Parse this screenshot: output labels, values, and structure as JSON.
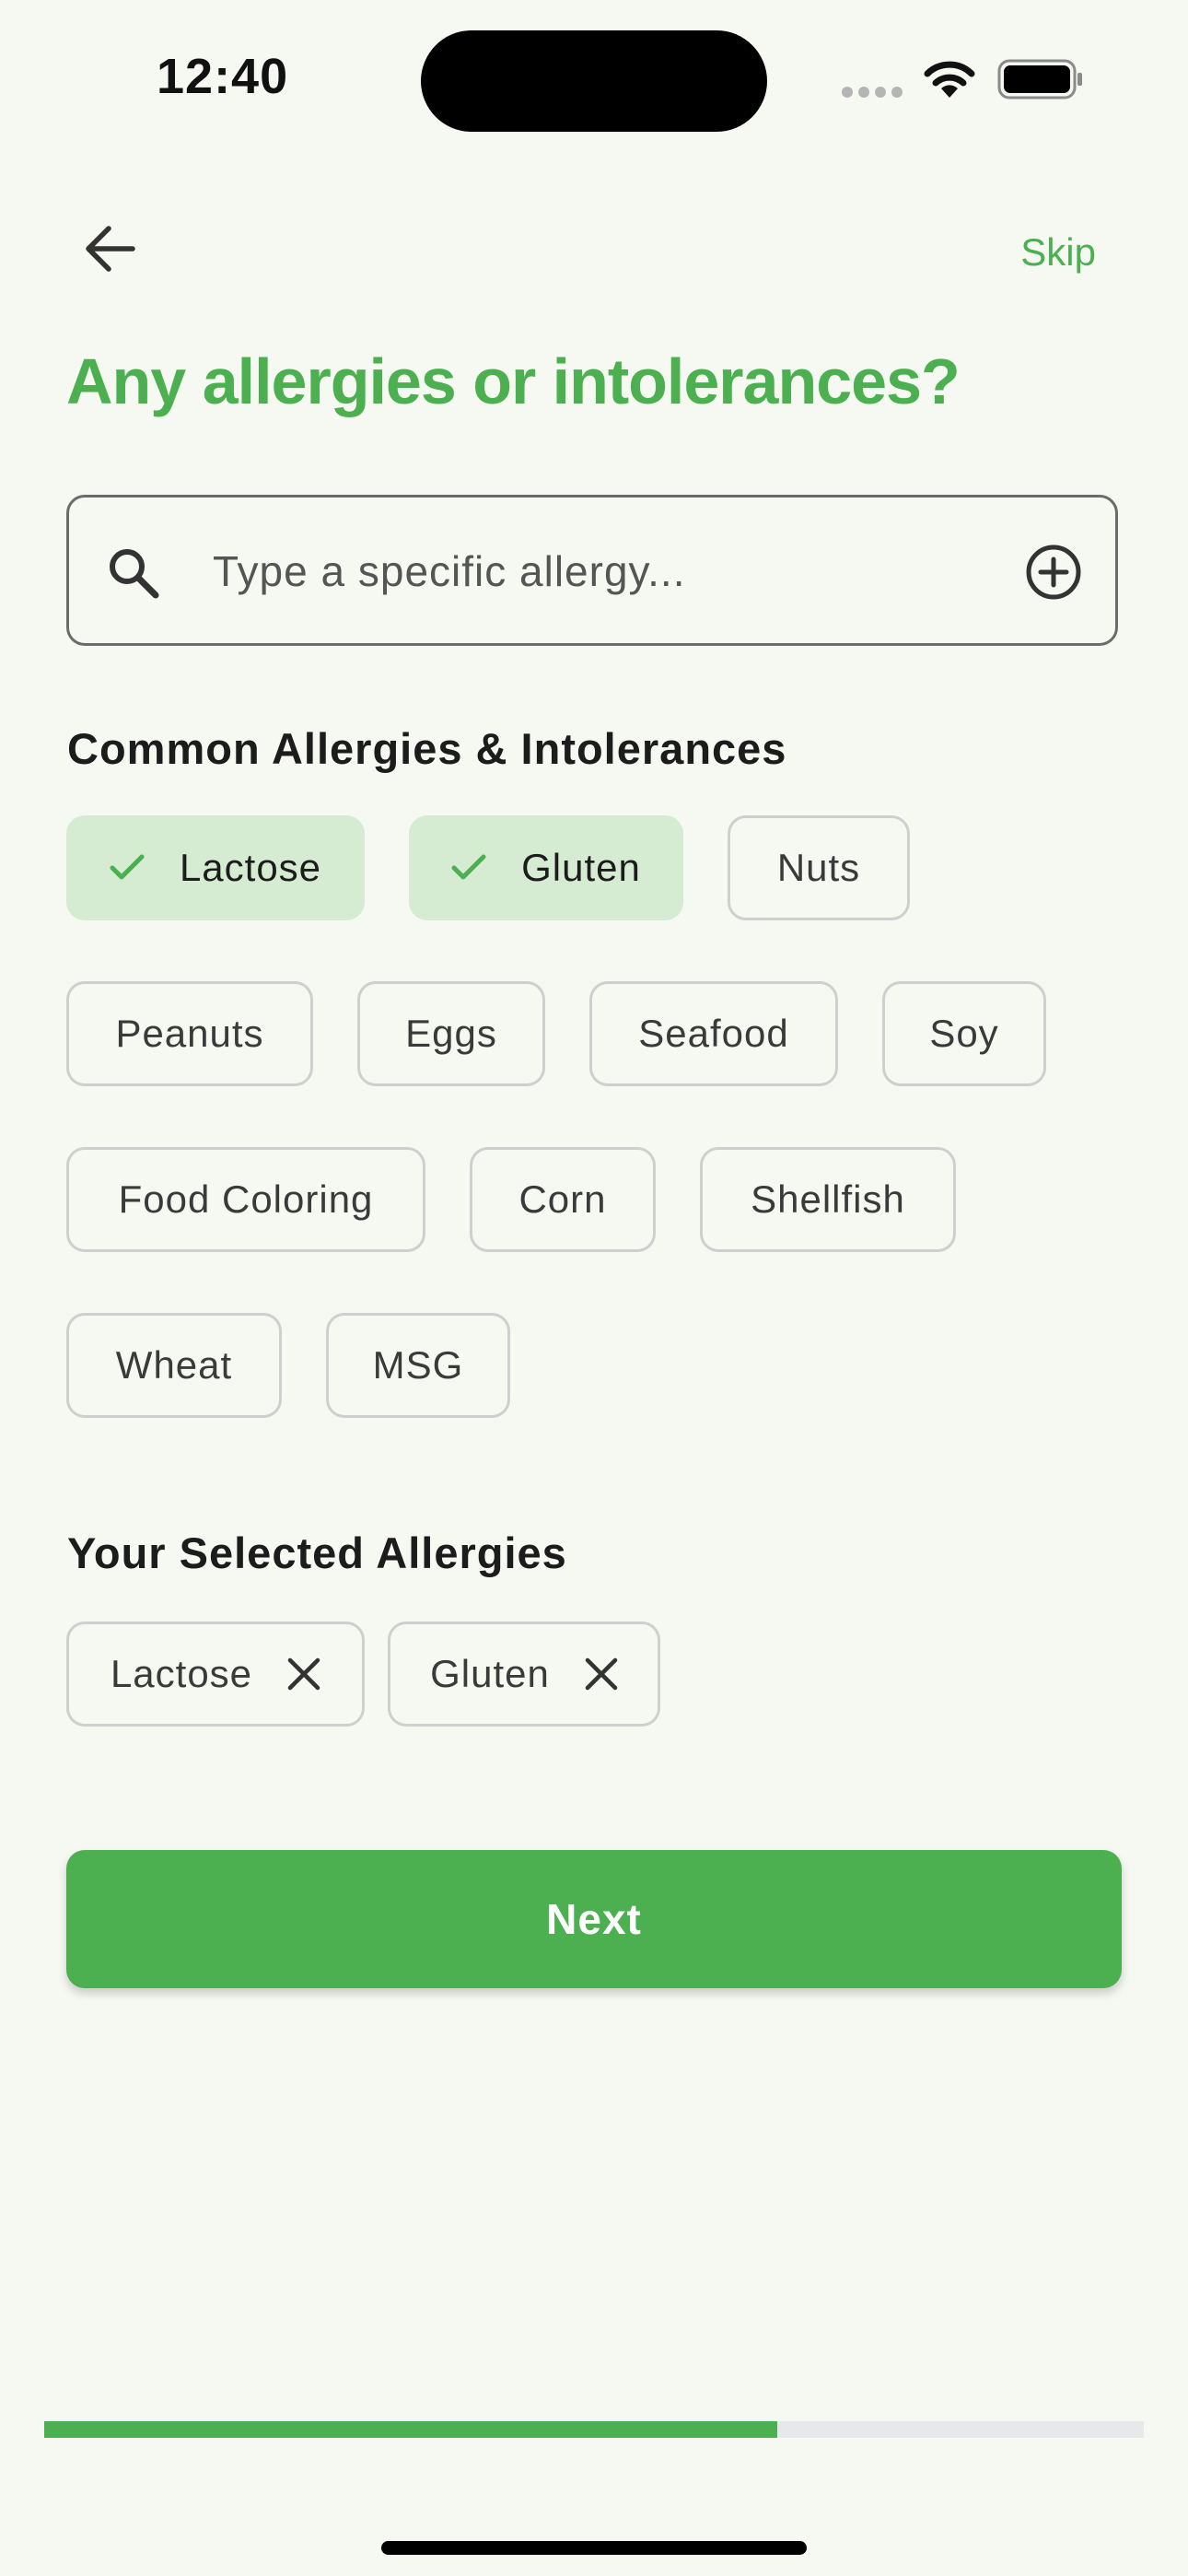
{
  "status_bar": {
    "time": "12:40"
  },
  "nav": {
    "skip_label": "Skip"
  },
  "title": "Any allergies or intolerances?",
  "search": {
    "placeholder": "Type a specific allergy...",
    "value": ""
  },
  "common": {
    "heading": "Common Allergies & Intolerances",
    "chips": [
      {
        "label": "Lactose",
        "selected": true
      },
      {
        "label": "Gluten",
        "selected": true
      },
      {
        "label": "Nuts",
        "selected": false
      },
      {
        "label": "Peanuts",
        "selected": false
      },
      {
        "label": "Eggs",
        "selected": false
      },
      {
        "label": "Seafood",
        "selected": false
      },
      {
        "label": "Soy",
        "selected": false
      },
      {
        "label": "Food Coloring",
        "selected": false
      },
      {
        "label": "Corn",
        "selected": false
      },
      {
        "label": "Shellfish",
        "selected": false
      },
      {
        "label": "Wheat",
        "selected": false
      },
      {
        "label": "MSG",
        "selected": false
      }
    ]
  },
  "selected": {
    "heading": "Your Selected Allergies",
    "items": [
      {
        "label": "Lactose"
      },
      {
        "label": "Gluten"
      }
    ]
  },
  "next_label": "Next",
  "progress": {
    "fraction": 0.667
  },
  "colors": {
    "accent": "#4caf50",
    "selected_chip_bg": "#d6ecd2",
    "background": "#f6f9f2"
  },
  "icons": {
    "back": "arrow-left-icon",
    "search": "search-icon",
    "add": "plus-circle-icon",
    "check": "check-icon",
    "remove": "close-icon"
  }
}
